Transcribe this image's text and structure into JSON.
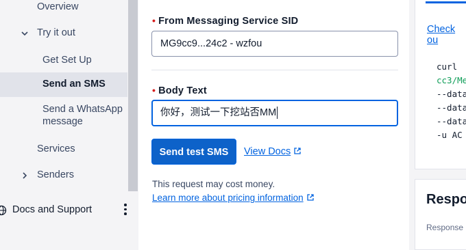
{
  "sidebar": {
    "items": [
      {
        "label": "Overview"
      },
      {
        "label": "Try it out"
      },
      {
        "label": "Get Set Up"
      },
      {
        "label": "Send an SMS"
      },
      {
        "label": "Send a WhatsApp"
      },
      {
        "label": "message"
      },
      {
        "label": "Services"
      },
      {
        "label": "Senders"
      }
    ],
    "docs_label": "Docs and Support"
  },
  "form": {
    "from_label": "From Messaging Service SID",
    "from_value": "MG9cc9...24c2 - wzfou",
    "body_label": "Body Text",
    "body_value": "你好，测试一下挖站否MM",
    "send_button": "Send test SMS",
    "view_docs": "View Docs",
    "cost_note": "This request may cost money.",
    "pricing_link": "Learn more about pricing information"
  },
  "right_panel": {
    "check_out_link": "Check ou",
    "code_lines": [
      "curl",
      "cc3/Me",
      "--data",
      "--data",
      "--data",
      "-u AC"
    ],
    "response_title": "Respo",
    "response_sub": "Response"
  },
  "colors": {
    "accent": "#0263e0",
    "button": "#0d62c9",
    "required": "#d61f1f",
    "sidebar_bg": "#f4f4f6",
    "active_bg": "#e1e3ea"
  }
}
